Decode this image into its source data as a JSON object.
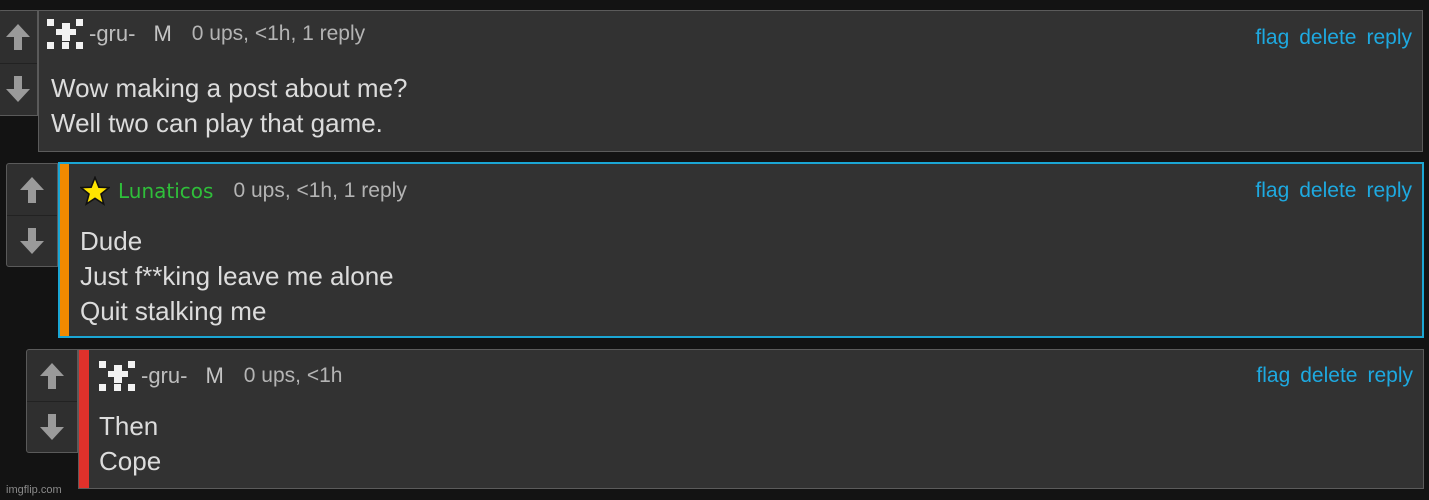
{
  "comments": [
    {
      "username": "-gru-",
      "badge": "M",
      "meta": "0 ups, <1h, 1 reply",
      "lines": "Wow making a post about me?\nWell two can play that game.",
      "actions": [
        "flag",
        "delete",
        "reply"
      ],
      "avatar_icon": "pixel-avatar-icon"
    },
    {
      "username": "Lunaticos",
      "meta": "0 ups, <1h, 1 reply",
      "lines": "Dude\nJust f**king leave me alone\nQuit stalking me",
      "actions": [
        "flag",
        "delete",
        "reply"
      ],
      "avatar_icon": "star-icon",
      "bar_color": "#f28a00",
      "border_color": "#1ba6d4"
    },
    {
      "username": "-gru-",
      "badge": "M",
      "meta": "0 ups, <1h",
      "lines": "Then\nCope",
      "actions": [
        "flag",
        "delete",
        "reply"
      ],
      "avatar_icon": "pixel-avatar-icon",
      "bar_color": "#e0312b"
    }
  ],
  "watermark": "imgflip.com",
  "colors": {
    "link": "#1ea9e0",
    "username_green": "#2fbf3a",
    "background": "#131313",
    "panel": "#323232"
  }
}
